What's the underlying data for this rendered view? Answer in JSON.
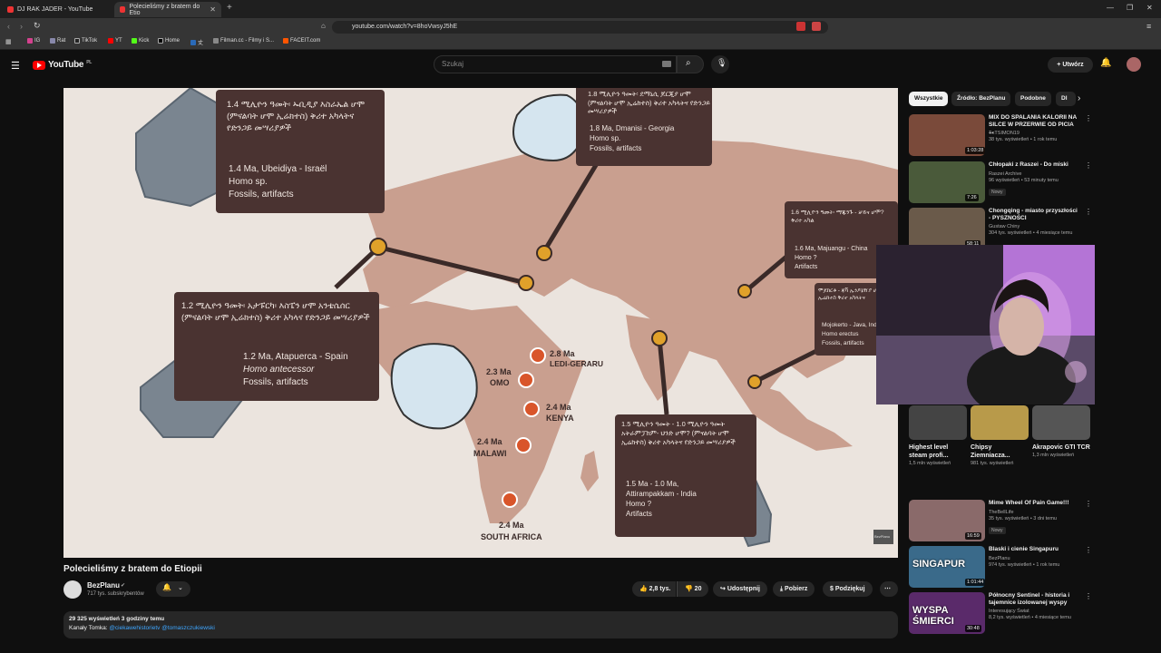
{
  "tabs": [
    {
      "title": "DJ RAK JADER - YouTube"
    },
    {
      "title": "Polecieliśmy z bratem do Etio"
    }
  ],
  "address": "youtube.com/watch?v=8hoVwsyJ5hE",
  "bookmarks": [
    "IG",
    "Rat",
    "TikTok",
    "YT",
    "Kick",
    "Home",
    "丈",
    "Filman.cc - Filmy i S...",
    "FACEIT.com"
  ],
  "yt": {
    "logo": "YouTube",
    "region": "PL",
    "search_placeholder": "Szukaj",
    "create": "Utwórz"
  },
  "map": {
    "label_14_amh": "1.4 ሚሊዮን ዓመት፡ ኡቢዲያ እስራኤል ሆሞ (ምናልባት ሆሞ ኢሬክተስ) ቅሪተ አካላትና የድንጋይ መሣሪያዎች",
    "label_14_en_1": "1.4 Ma, Ubeidiya - Israël",
    "label_14_en_2": "Homo sp.",
    "label_14_en_3": "Fossils, artifacts",
    "label_18_amh": "1.8 ሚሊዮን ዓመት፡ ደማኒሲ ጆርጂያ ሆሞ (ምናልባት ሆሞ ኢሬክተስ) ቅሪተ አካላትና የድንጋይ መሣሪያዎች",
    "label_18_en_1": "1.8 Ma, Dmanisi - Georgia",
    "label_18_en_2": "Homo sp.",
    "label_18_en_3": "Fossils, artifacts",
    "label_16_amh": "1.6 ሚሊዮን ዓመት፡ ማጁንጉ - ቻይና ሆሞ? ቅሪተ አካል",
    "label_16_en_1": "1.6 Ma, Majuangu - China",
    "label_16_en_2": "Homo ?",
    "label_16_en_3": "Artifacts",
    "label_java_amh": "ሞጆከርቶ - ጃቫ ኢንዶኔዥያ ሆሞ ኢሬክተስ ቅሪተ አካላትና",
    "label_java_en_1": "Mojokerto - Java, Indo",
    "label_java_en_2": "Homo erectus",
    "label_java_en_3": "Fossils, artifacts",
    "label_12_amh": "1.2 ሚሊዮን ዓመት፡ አታፑርካ፡ እስፔን ሆሞ አንቴሴሰር (ምናልባት ሆሞ ኢሬክተስ) ቅሪተ አካላና የድንጋይ መሣሪያዎች",
    "label_12_en_1": "1.2 Ma, Atapuerca - Spain",
    "label_12_en_2": "Homo antecessor",
    "label_12_en_3": "Fossils, artifacts",
    "label_15_amh": "1.5 ሚሊዮን ዓመት - 1.0 ሚሊዮን ዓመት አትራምፓክም- ህንድ ሆሞ? (ምናልባት ሆሞ ኢሬክተስ) ቅሪተ አካላትና የድንጋይ መሣሪያዎች",
    "label_15_en_1": "1.5 Ma - 1.0 Ma,",
    "label_15_en_2": "Attirampakkam - India",
    "label_15_en_3": "Homo ?",
    "label_15_en_4": "Artifacts",
    "site_ledi_age": "2.8 Ma",
    "site_ledi": "LEDI-GERARU",
    "site_omo_age": "2.3 Ma",
    "site_omo": "OMO",
    "site_kenya_age": "2.4 Ma",
    "site_kenya": "KENYA",
    "site_malawi_age": "2.4 Ma",
    "site_malawi": "MALAWI",
    "site_sa_age": "2.4 Ma",
    "site_sa": "SOUTH AFRICA",
    "watermark": "BezPlanu"
  },
  "video": {
    "title": "Polecieliśmy z bratem do Etiopii",
    "channel": "BezPlanu",
    "subs": "717 tys. subskrybentów",
    "likes": "2,8 tys.",
    "dislikes": "20",
    "share": "Udostępnij",
    "download": "Pobierz",
    "thanks": "Podziękuj",
    "views": "29 325 wyświetleń  3 godziny temu",
    "desc_prefix": "Kanały Tomka: ",
    "desc_links": "@ciekawehistorietv @tomaszczukiewski"
  },
  "chips": [
    "Wszystkie",
    "Źródło: BezPlanu",
    "Podobne",
    "Dl"
  ],
  "recs": [
    {
      "title": "MIX DO SPALANIA KALORII NA SILCE W PRZERWIE OD PICIA ...",
      "channel": "TnTSIMON19",
      "meta": "38 tys. wyświetleń • 1 rok temu",
      "dur": "1:03:28",
      "color": "#7a4a3a"
    },
    {
      "title": "Chłopaki z Raszei - Do miski",
      "channel": "Raszei Archive",
      "meta": "96 wyświetleń • 53 minuty temu",
      "badge": "Nowy",
      "dur": "7:26",
      "color": "#4a5a3a"
    },
    {
      "title": "Chongqing - miasto przyszłości - PYSZNOŚCI",
      "channel": "Gustaw Chiny",
      "meta": "304 tys. wyświetleń • 4 miesiące temu",
      "dur": "58:11",
      "color": "#6a5a4a"
    },
    {
      "title": "Mime Wheel Of Pain Game!!!",
      "channel": "TheBellLife",
      "meta": "35 tys. wyświetleń • 3 dni temu",
      "badge": "Nowy",
      "dur": "16:59",
      "color": "#8a6a6a"
    },
    {
      "title": "Blaski i cienie Singapuru",
      "channel": "BezPlanu",
      "meta": "974 tys. wyświetleń • 1 rok temu",
      "dur": "1:01:44",
      "color": "#3a6a8a",
      "thumbtext": "SINGAPUR"
    },
    {
      "title": "Północny Sentinel - historia i tajemnice izolowanej wyspy",
      "channel": "Interesujący Świat",
      "meta": "8,2 tys. wyświetleń • 4 miesiące temu",
      "dur": "30:48",
      "color": "#5a2a6a",
      "thumbtext": "WYSPA ŚMIERCI"
    }
  ],
  "shorts": [
    {
      "title": "Highest level steam profi...",
      "views": "1,5 mln wyświetleń",
      "color": "#444"
    },
    {
      "title": "Chipsy Ziemniacza...",
      "views": "981 tys. wyświetleń",
      "color": "#b89a4a"
    },
    {
      "title": "Akrapovic GTI TCR",
      "views": "1,3 mln wyświetleń",
      "color": "#555"
    }
  ]
}
